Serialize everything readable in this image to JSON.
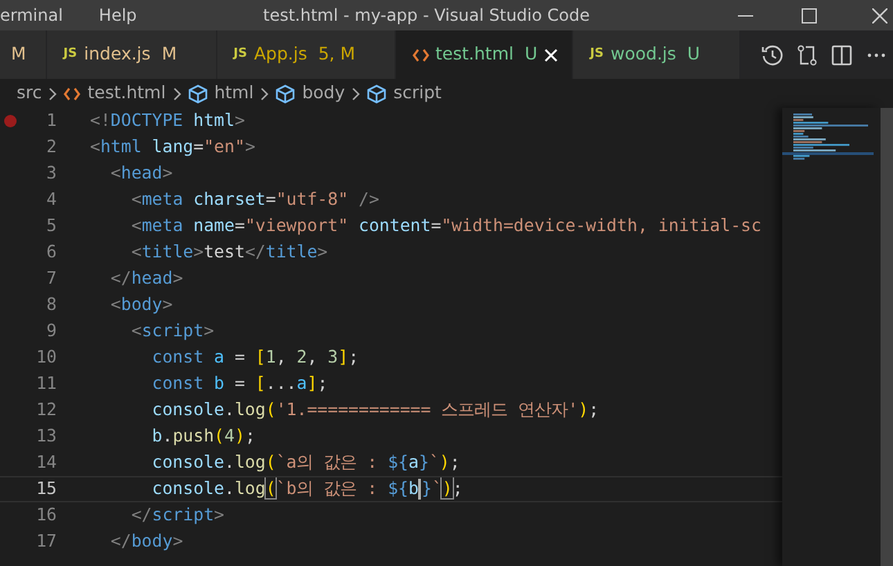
{
  "title_bar": {
    "menus": [
      "erminal",
      "Help"
    ],
    "title": "test.html - my-app - Visual Studio Code"
  },
  "tabs": [
    {
      "kind": "cut",
      "badge": "M",
      "color": "#e2c08d",
      "selected": false
    },
    {
      "kind": "js",
      "icon": "JS",
      "label": "index.js",
      "badge": "M",
      "color": "#e2c08d",
      "selected": false
    },
    {
      "kind": "js",
      "icon": "JS",
      "label": "App.js",
      "badge": "5, M",
      "color": "#cca700",
      "selected": false
    },
    {
      "kind": "html",
      "label": "test.html",
      "badge": "U",
      "color": "#73c991",
      "selected": true
    },
    {
      "kind": "js",
      "icon": "JS",
      "label": "wood.js",
      "badge": "U",
      "color": "#73c991",
      "selected": false
    }
  ],
  "breadcrumbs": [
    {
      "kind": "folder",
      "label": "src"
    },
    {
      "kind": "file",
      "label": "test.html"
    },
    {
      "kind": "element",
      "label": "html"
    },
    {
      "kind": "element",
      "label": "body"
    },
    {
      "kind": "element",
      "label": "script"
    }
  ],
  "lines": [
    {
      "number": "1",
      "breakpoint": true,
      "current": false,
      "tokens": [
        {
          "kind": "punct",
          "text": "<!"
        },
        {
          "kind": "tag",
          "text": "DOCTYPE "
        },
        {
          "kind": "attr",
          "text": "html"
        },
        {
          "kind": "punct",
          "text": ">"
        }
      ]
    },
    {
      "number": "2",
      "breakpoint": false,
      "current": false,
      "tokens": [
        {
          "kind": "punct",
          "text": "<"
        },
        {
          "kind": "tag",
          "text": "html "
        },
        {
          "kind": "attr",
          "text": "lang"
        },
        {
          "kind": "plain",
          "text": "="
        },
        {
          "kind": "str",
          "text": "\"en\""
        },
        {
          "kind": "punct",
          "text": ">"
        }
      ]
    },
    {
      "number": "3",
      "breakpoint": false,
      "current": false,
      "tokens": [
        {
          "kind": "punct",
          "text": "  <"
        },
        {
          "kind": "tag",
          "text": "head"
        },
        {
          "kind": "punct",
          "text": ">"
        }
      ]
    },
    {
      "number": "4",
      "breakpoint": false,
      "current": false,
      "tokens": [
        {
          "kind": "punct",
          "text": "    <"
        },
        {
          "kind": "tag",
          "text": "meta "
        },
        {
          "kind": "attr",
          "text": "charset"
        },
        {
          "kind": "plain",
          "text": "="
        },
        {
          "kind": "str",
          "text": "\"utf-8\""
        },
        {
          "kind": "punct",
          "text": " />"
        }
      ]
    },
    {
      "number": "5",
      "breakpoint": false,
      "current": false,
      "tokens": [
        {
          "kind": "punct",
          "text": "    <"
        },
        {
          "kind": "tag",
          "text": "meta "
        },
        {
          "kind": "attr",
          "text": "name"
        },
        {
          "kind": "plain",
          "text": "="
        },
        {
          "kind": "str",
          "text": "\"viewport\""
        },
        {
          "kind": "attr",
          "text": " content"
        },
        {
          "kind": "plain",
          "text": "="
        },
        {
          "kind": "str",
          "text": "\"width=device-width, initial-sc"
        }
      ]
    },
    {
      "number": "6",
      "breakpoint": false,
      "current": false,
      "tokens": [
        {
          "kind": "punct",
          "text": "    <"
        },
        {
          "kind": "tag",
          "text": "title"
        },
        {
          "kind": "punct",
          "text": ">"
        },
        {
          "kind": "plain",
          "text": "test"
        },
        {
          "kind": "punct",
          "text": "</"
        },
        {
          "kind": "tag",
          "text": "title"
        },
        {
          "kind": "punct",
          "text": ">"
        }
      ]
    },
    {
      "number": "7",
      "breakpoint": false,
      "current": false,
      "tokens": [
        {
          "kind": "punct",
          "text": "  </"
        },
        {
          "kind": "tag",
          "text": "head"
        },
        {
          "kind": "punct",
          "text": ">"
        }
      ]
    },
    {
      "number": "8",
      "breakpoint": false,
      "current": false,
      "tokens": [
        {
          "kind": "punct",
          "text": "  <"
        },
        {
          "kind": "tag",
          "text": "body"
        },
        {
          "kind": "punct",
          "text": ">"
        }
      ]
    },
    {
      "number": "9",
      "breakpoint": false,
      "current": false,
      "tokens": [
        {
          "kind": "punct",
          "text": "    <"
        },
        {
          "kind": "tag",
          "text": "script"
        },
        {
          "kind": "punct",
          "text": ">"
        }
      ]
    },
    {
      "number": "10",
      "breakpoint": false,
      "current": false,
      "tokens": [
        {
          "kind": "kw",
          "text": "      const "
        },
        {
          "kind": "const",
          "text": "a"
        },
        {
          "kind": "plain",
          "text": " = "
        },
        {
          "kind": "br",
          "text": "["
        },
        {
          "kind": "num",
          "text": "1"
        },
        {
          "kind": "plain",
          "text": ", "
        },
        {
          "kind": "num",
          "text": "2"
        },
        {
          "kind": "plain",
          "text": ", "
        },
        {
          "kind": "num",
          "text": "3"
        },
        {
          "kind": "br",
          "text": "]"
        },
        {
          "kind": "plain",
          "text": ";"
        }
      ]
    },
    {
      "number": "11",
      "breakpoint": false,
      "current": false,
      "tokens": [
        {
          "kind": "kw",
          "text": "      const "
        },
        {
          "kind": "const",
          "text": "b"
        },
        {
          "kind": "plain",
          "text": " = "
        },
        {
          "kind": "br",
          "text": "["
        },
        {
          "kind": "plain",
          "text": "..."
        },
        {
          "kind": "const",
          "text": "a"
        },
        {
          "kind": "br",
          "text": "]"
        },
        {
          "kind": "plain",
          "text": ";"
        }
      ]
    },
    {
      "number": "12",
      "breakpoint": false,
      "current": false,
      "tokens": [
        {
          "kind": "var",
          "text": "      console"
        },
        {
          "kind": "plain",
          "text": "."
        },
        {
          "kind": "fn",
          "text": "log"
        },
        {
          "kind": "br",
          "text": "("
        },
        {
          "kind": "str",
          "text": "'1.============ 스프레드 연산자'"
        },
        {
          "kind": "br",
          "text": ")"
        },
        {
          "kind": "plain",
          "text": ";"
        }
      ]
    },
    {
      "number": "13",
      "breakpoint": false,
      "current": false,
      "tokens": [
        {
          "kind": "var",
          "text": "      b"
        },
        {
          "kind": "plain",
          "text": "."
        },
        {
          "kind": "fn",
          "text": "push"
        },
        {
          "kind": "br",
          "text": "("
        },
        {
          "kind": "num",
          "text": "4"
        },
        {
          "kind": "br",
          "text": ")"
        },
        {
          "kind": "plain",
          "text": ";"
        }
      ]
    },
    {
      "number": "14",
      "breakpoint": false,
      "current": false,
      "tokens": [
        {
          "kind": "var",
          "text": "      console"
        },
        {
          "kind": "plain",
          "text": "."
        },
        {
          "kind": "fn",
          "text": "log"
        },
        {
          "kind": "br",
          "text": "("
        },
        {
          "kind": "str",
          "text": "`a의 값은 : "
        },
        {
          "kind": "interp",
          "text": "${"
        },
        {
          "kind": "var",
          "text": "a"
        },
        {
          "kind": "interp",
          "text": "}"
        },
        {
          "kind": "str",
          "text": "`"
        },
        {
          "kind": "br",
          "text": ")"
        },
        {
          "kind": "plain",
          "text": ";"
        }
      ]
    },
    {
      "number": "15",
      "breakpoint": false,
      "current": true,
      "tokens": [
        {
          "kind": "var",
          "text": "      console"
        },
        {
          "kind": "plain",
          "text": "."
        },
        {
          "kind": "fn",
          "text": "log"
        },
        {
          "kind": "br",
          "text": "(",
          "matched": true
        },
        {
          "kind": "str",
          "text": "`b의 값은 : "
        },
        {
          "kind": "interp",
          "text": "${"
        },
        {
          "kind": "var",
          "text": "b",
          "cursor": true
        },
        {
          "kind": "interp",
          "text": "}"
        },
        {
          "kind": "str",
          "text": "`"
        },
        {
          "kind": "br",
          "text": ")",
          "matched": true
        },
        {
          "kind": "plain",
          "text": ";"
        }
      ]
    },
    {
      "number": "16",
      "breakpoint": false,
      "current": false,
      "tokens": [
        {
          "kind": "punct",
          "text": "    </"
        },
        {
          "kind": "tag",
          "text": "script"
        },
        {
          "kind": "punct",
          "text": ">"
        }
      ]
    },
    {
      "number": "17",
      "breakpoint": false,
      "current": false,
      "tokens": [
        {
          "kind": "punct",
          "text": "  </"
        },
        {
          "kind": "tag",
          "text": "body"
        },
        {
          "kind": "punct",
          "text": ">"
        }
      ]
    }
  ]
}
